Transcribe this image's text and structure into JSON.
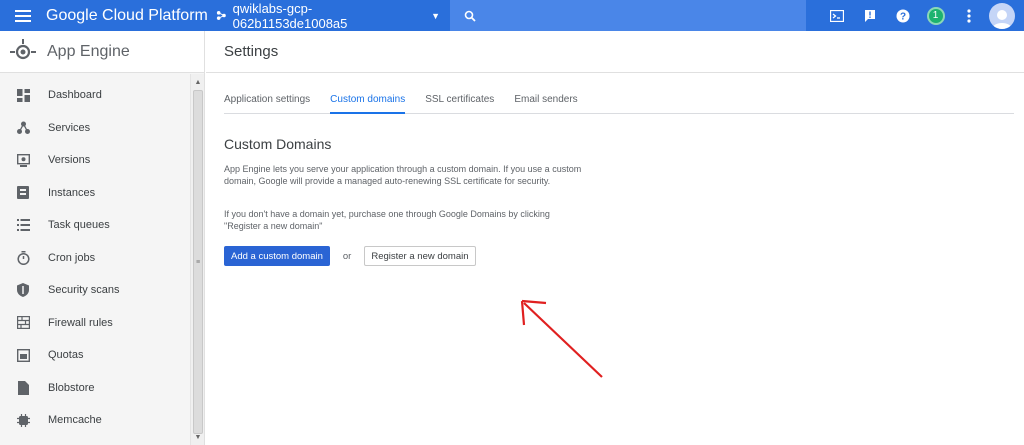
{
  "topbar": {
    "brand": "Google Cloud Platform",
    "project": "qwiklabs-gcp-062b1153de1008a5",
    "notification_count": "1",
    "colors": {
      "bar": "#2a6fdb",
      "search": "#4a86e8"
    }
  },
  "sidebar": {
    "title": "App Engine",
    "items": [
      {
        "label": "Dashboard",
        "icon": "dashboard-icon"
      },
      {
        "label": "Services",
        "icon": "services-icon"
      },
      {
        "label": "Versions",
        "icon": "versions-icon"
      },
      {
        "label": "Instances",
        "icon": "instances-icon"
      },
      {
        "label": "Task queues",
        "icon": "task-queues-icon"
      },
      {
        "label": "Cron jobs",
        "icon": "cron-jobs-icon"
      },
      {
        "label": "Security scans",
        "icon": "security-scans-icon"
      },
      {
        "label": "Firewall rules",
        "icon": "firewall-rules-icon"
      },
      {
        "label": "Quotas",
        "icon": "quotas-icon"
      },
      {
        "label": "Blobstore",
        "icon": "blobstore-icon"
      },
      {
        "label": "Memcache",
        "icon": "memcache-icon"
      }
    ]
  },
  "main": {
    "title": "Settings",
    "tabs": [
      {
        "label": "Application settings",
        "active": false
      },
      {
        "label": "Custom domains",
        "active": true
      },
      {
        "label": "SSL certificates",
        "active": false
      },
      {
        "label": "Email senders",
        "active": false
      }
    ],
    "section_title": "Custom Domains",
    "description_1": "App Engine lets you serve your application through a custom domain. If you use a custom domain, Google will provide a managed auto-renewing SSL certificate for security.",
    "description_2": "If you don't have a domain yet, purchase one through Google Domains by clicking \"Register a new domain\"",
    "primary_button": "Add a custom domain",
    "or_text": "or",
    "secondary_button": "Register a new domain",
    "annotation_color": "#e02020"
  }
}
